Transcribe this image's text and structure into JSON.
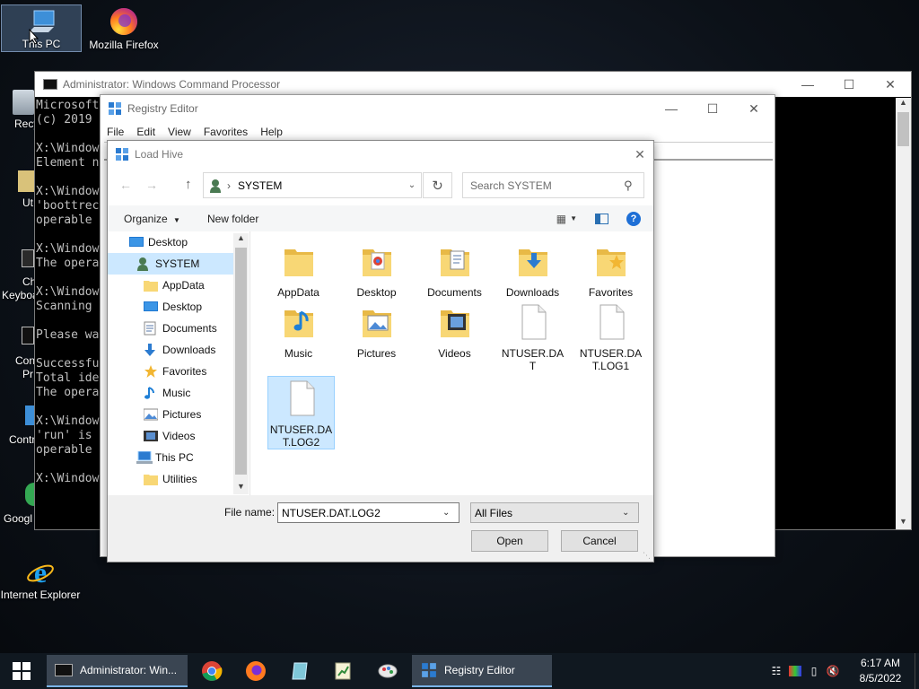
{
  "desktop": {
    "icons": [
      {
        "label": "This PC"
      },
      {
        "label": "Mozilla Firefox"
      },
      {
        "label": "Internet Explorer"
      }
    ],
    "partial_labels": [
      "Recy",
      "Ut",
      "Ch",
      "Keyboa",
      "Con",
      "Pr",
      "Contr",
      "Googl"
    ]
  },
  "cmd": {
    "title": "Administrator: Windows Command Processor",
    "lines": [
      "Microsoft",
      "(c) 2019",
      "",
      "X:\\Window",
      "Element n",
      "",
      "X:\\Window",
      "'boottrec",
      "operable",
      "",
      "X:\\Window",
      "The opera",
      "",
      "X:\\Window",
      "Scanning",
      "",
      "Please wa",
      "",
      "Successfu",
      "Total ide",
      "The opera",
      "",
      "X:\\Window",
      "'run' is",
      "operable",
      "",
      "X:\\Window"
    ]
  },
  "regedit": {
    "title": "Registry Editor",
    "menu": [
      "File",
      "Edit",
      "View",
      "Favorites",
      "Help"
    ]
  },
  "dialog": {
    "title": "Load Hive",
    "address": "SYSTEM",
    "search_placeholder": "Search SYSTEM",
    "organize_label": "Organize",
    "new_folder_label": "New folder",
    "nav_items": [
      {
        "label": "Desktop",
        "icon": "desktop-icon",
        "indent": 0
      },
      {
        "label": "SYSTEM",
        "icon": "user-icon",
        "indent": 1,
        "selected": true
      },
      {
        "label": "AppData",
        "icon": "folder-icon",
        "indent": 2
      },
      {
        "label": "Desktop",
        "icon": "desktop-icon",
        "indent": 2
      },
      {
        "label": "Documents",
        "icon": "documents-icon",
        "indent": 2
      },
      {
        "label": "Downloads",
        "icon": "downloads-icon",
        "indent": 2
      },
      {
        "label": "Favorites",
        "icon": "favorites-icon",
        "indent": 2
      },
      {
        "label": "Music",
        "icon": "music-icon",
        "indent": 2
      },
      {
        "label": "Pictures",
        "icon": "pictures-icon",
        "indent": 2
      },
      {
        "label": "Videos",
        "icon": "videos-icon",
        "indent": 2
      },
      {
        "label": "This PC",
        "icon": "this-pc-icon",
        "indent": 1
      },
      {
        "label": "Utilities",
        "icon": "folder-icon",
        "indent": 2
      }
    ],
    "files": [
      {
        "label": "AppData",
        "type": "folder"
      },
      {
        "label": "Desktop",
        "type": "folder"
      },
      {
        "label": "Documents",
        "type": "folder"
      },
      {
        "label": "Downloads",
        "type": "folder"
      },
      {
        "label": "Favorites",
        "type": "folder"
      },
      {
        "label": "Music",
        "type": "folder"
      },
      {
        "label": "Pictures",
        "type": "folder"
      },
      {
        "label": "Videos",
        "type": "folder"
      },
      {
        "label": "NTUSER.DA\nT",
        "type": "file"
      },
      {
        "label": "NTUSER.DA\nT.LOG1",
        "type": "file"
      },
      {
        "label": "NTUSER.DA\nT.LOG2",
        "type": "file",
        "selected": true
      }
    ],
    "file_name_label": "File name:",
    "file_name_value": "NTUSER.DAT.LOG2",
    "file_type_value": "All Files",
    "open_label": "Open",
    "cancel_label": "Cancel"
  },
  "taskbar": {
    "cmd_label": "Administrator: Win...",
    "regedit_label": "Registry Editor",
    "time": "6:17 AM",
    "date": "8/5/2022"
  },
  "colors": {
    "accent": "#0078d7",
    "folder": "#f8d775",
    "selection": "#cce8ff"
  }
}
